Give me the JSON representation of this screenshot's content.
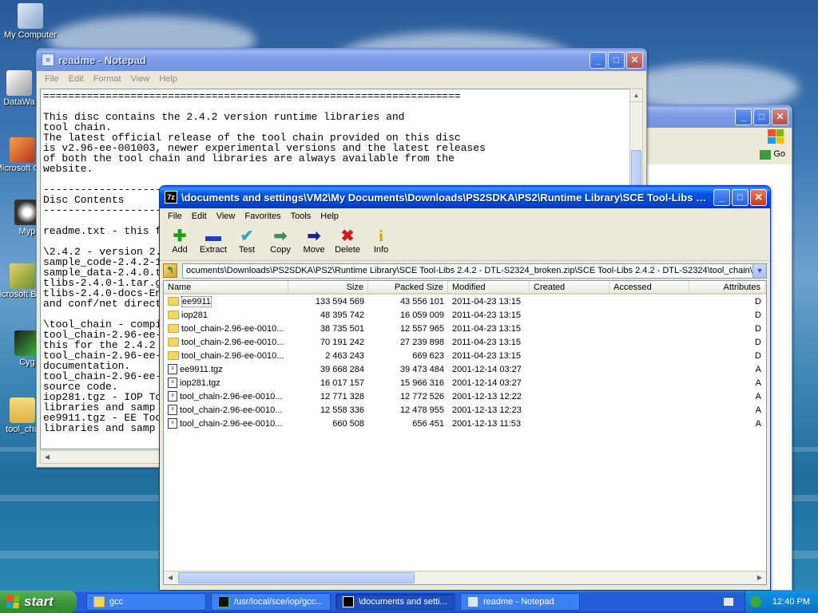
{
  "desktop": {
    "icons": [
      {
        "label": "My Computer"
      },
      {
        "label": "DataWa"
      },
      {
        "label": "Microsoft C++"
      },
      {
        "label": "Myp"
      },
      {
        "label": "Microsoft Basic"
      },
      {
        "label": "Cyg"
      },
      {
        "label": "tool_cha"
      }
    ]
  },
  "back_window": {
    "address_go": "Go"
  },
  "notepad": {
    "title": "readme - Notepad",
    "menu": [
      "File",
      "Edit",
      "Format",
      "View",
      "Help"
    ],
    "text": "===================================================================\n\nThis disc contains the 2.4.2 version runtime libraries and\ntool chain.\nThe latest official release of the tool chain provided on this disc\nis v2.96-ee-001003, newer experimental versions and the latest releases\nof both the tool chain and libraries are always available from the\nwebsite.\n\n-------------------------------------------------------------------\nDisc Contents\n-------------------------------------------------------------------\n\nreadme.txt - this f\n\n\\2.4.2 - version 2.\nsample_code-2.4.2-1\nsample_data-2.4.0.t\ntlibs-2.4.0-1.tar.g\ntlibs-2.4.0-docs-En\nand conf/net direct\n\n\\tool_chain - compi\ntool_chain-2.96-ee-\nthis for the 2.4.2\ntool_chain-2.96-ee-\ndocumentation.\ntool_chain-2.96-ee-\nsource code.\niop281.tgz - IOP To\nlibraries and samp\nee9911.tgz - EE Too\nlibraries and samp"
  },
  "sevenzip": {
    "title": "\\documents and settings\\VM2\\My Documents\\Downloads\\PS2SDKA\\PS2\\Runtime Library\\SCE Tool-Libs 2.4...",
    "icon_label": "7z",
    "menu": [
      "File",
      "Edit",
      "View",
      "Favorites",
      "Tools",
      "Help"
    ],
    "tools": [
      {
        "label": "Add",
        "glyph": "✚",
        "color": "#1aa01a"
      },
      {
        "label": "Extract",
        "glyph": "▬",
        "color": "#1f3fbf"
      },
      {
        "label": "Test",
        "glyph": "✔",
        "color": "#2aa7c9"
      },
      {
        "label": "Copy",
        "glyph": "➡",
        "color": "#3a8f5a"
      },
      {
        "label": "Move",
        "glyph": "➡",
        "color": "#15208a"
      },
      {
        "label": "Delete",
        "glyph": "✖",
        "color": "#d11a1a"
      },
      {
        "label": "Info",
        "glyph": "i",
        "color": "#c9a500"
      }
    ],
    "address": "ocuments\\Downloads\\PS2SDKA\\PS2\\Runtime Library\\SCE Tool-Libs 2.4.2 - DTL-S2324_broken.zip\\SCE Tool-Libs 2.4.2 - DTL-S2324\\tool_chain\\",
    "columns": [
      "Name",
      "Size",
      "Packed Size",
      "Modified",
      "Created",
      "Accessed",
      "Attributes"
    ],
    "rows": [
      {
        "name": "ee9911",
        "size": "133 594 569",
        "packed": "43 556 101",
        "modified": "2011-04-23 13:15",
        "attr": "D",
        "type": "folder"
      },
      {
        "name": "iop281",
        "size": "48 395 742",
        "packed": "16 059 009",
        "modified": "2011-04-23 13:15",
        "attr": "D",
        "type": "folder"
      },
      {
        "name": "tool_chain-2.96-ee-0010...",
        "size": "38 735 501",
        "packed": "12 557 965",
        "modified": "2011-04-23 13:15",
        "attr": "D",
        "type": "folder"
      },
      {
        "name": "tool_chain-2.96-ee-0010...",
        "size": "70 191 242",
        "packed": "27 239 898",
        "modified": "2011-04-23 13:15",
        "attr": "D",
        "type": "folder"
      },
      {
        "name": "tool_chain-2.96-ee-0010...",
        "size": "2 463 243",
        "packed": "669 623",
        "modified": "2011-04-23 13:15",
        "attr": "D",
        "type": "folder"
      },
      {
        "name": "ee9911.tgz",
        "size": "39 668 284",
        "packed": "39 473 484",
        "modified": "2001-12-14 03:27",
        "attr": "A",
        "type": "archive"
      },
      {
        "name": "iop281.tgz",
        "size": "16 017 157",
        "packed": "15 966 316",
        "modified": "2001-12-14 03:27",
        "attr": "A",
        "type": "archive"
      },
      {
        "name": "tool_chain-2.96-ee-0010...",
        "size": "12 771 328",
        "packed": "12 772 526",
        "modified": "2001-12-13 12:22",
        "attr": "A",
        "type": "archive"
      },
      {
        "name": "tool_chain-2.96-ee-0010...",
        "size": "12 558 336",
        "packed": "12 478 955",
        "modified": "2001-12-13 12:23",
        "attr": "A",
        "type": "archive"
      },
      {
        "name": "tool_chain-2.96-ee-0010...",
        "size": "660 508",
        "packed": "656 451",
        "modified": "2001-12-13 11:53",
        "attr": "A",
        "type": "archive"
      }
    ]
  },
  "taskbar": {
    "start_label": "start",
    "tasks": [
      {
        "label": "gcc"
      },
      {
        "label": "/usr/local/sce/iop/gcc..."
      },
      {
        "label": "\\documents and setti..."
      },
      {
        "label": "readme - Notepad"
      }
    ],
    "clock": "12:40 PM"
  }
}
